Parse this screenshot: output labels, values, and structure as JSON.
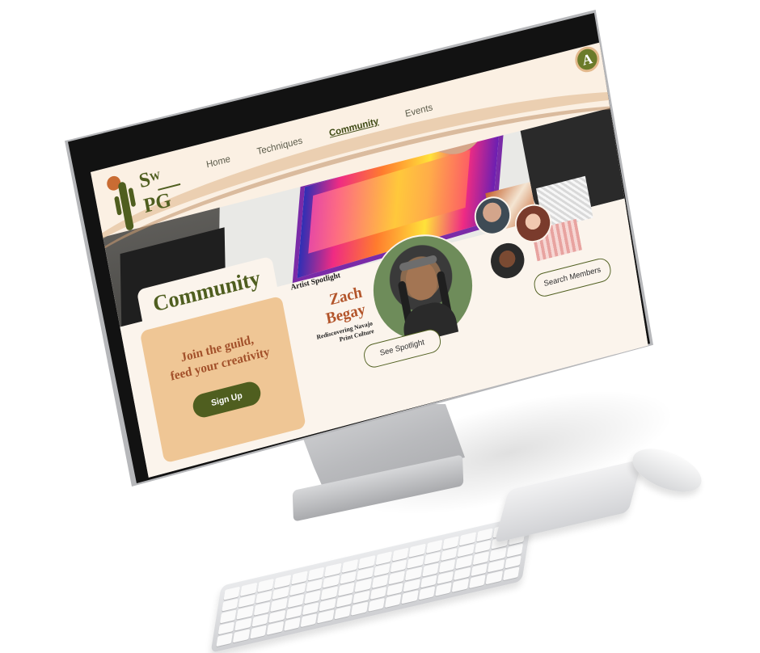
{
  "nav": {
    "items": [
      {
        "label": "Home",
        "active": false
      },
      {
        "label": "Techniques",
        "active": false
      },
      {
        "label": "Community",
        "active": true
      },
      {
        "label": "Events",
        "active": false
      }
    ]
  },
  "logo": {
    "line1": "S",
    "line1_sup": "W",
    "line2": "PG"
  },
  "account": {
    "initial": "A"
  },
  "page": {
    "title": "Community"
  },
  "join_card": {
    "line1": "Join the guild,",
    "line2": "feed your creativity",
    "button": "Sign Up"
  },
  "spotlight": {
    "label": "Artist Spotlight",
    "first_name": "Zach",
    "last_name": "Begay",
    "subtitle_line1": "Rediscovering Navajo",
    "subtitle_line2": "Print Culture",
    "button": "See Spotlight"
  },
  "members": {
    "button": "Search Members"
  },
  "colors": {
    "accent": "#4f5e1f",
    "highlight": "#b3552b",
    "card": "#efc695",
    "background": "#fbf4ec"
  }
}
